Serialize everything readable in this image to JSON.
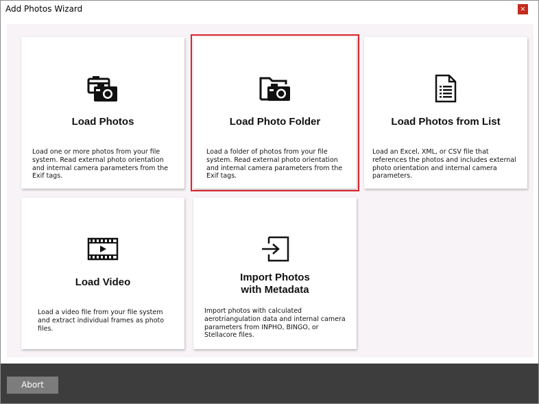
{
  "window": {
    "title": "Add Photos Wizard",
    "close_glyph": "×"
  },
  "cards": [
    {
      "title": "Load Photos",
      "description": "Load one or more photos from your file system. Read external photo orientation and internal camera parameters from the Exif tags.",
      "icon": "photos-camera-icon"
    },
    {
      "title": "Load Photo Folder",
      "description": "Load a folder of photos from your file system. Read external photo orientation and internal camera parameters from the Exif tags.",
      "icon": "folder-camera-icon",
      "selected": true
    },
    {
      "title": "Load Photos from List",
      "description": "Load an Excel, XML, or CSV file that references the photos and includes external photo orientation and internal camera parameters.",
      "icon": "document-list-icon"
    },
    {
      "title": "Load Video",
      "description": "Load a video file from your file system and extract individual frames as photo files.",
      "icon": "video-frame-icon"
    },
    {
      "title_line1": "Import Photos",
      "title_line2": "with Metadata",
      "description": "Import photos with calculated aerotriangulation data and internal camera parameters from INPHO, BINGO, or Stellacore files.",
      "icon": "import-arrow-icon"
    }
  ],
  "footer": {
    "abort_label": "Abort"
  },
  "colors": {
    "selection": "#d8232a",
    "panel_background": "#f8f3f7",
    "footer_background": "#3d3d3d",
    "button_background": "#7c7c7c",
    "close_button": "#c42b1c"
  }
}
